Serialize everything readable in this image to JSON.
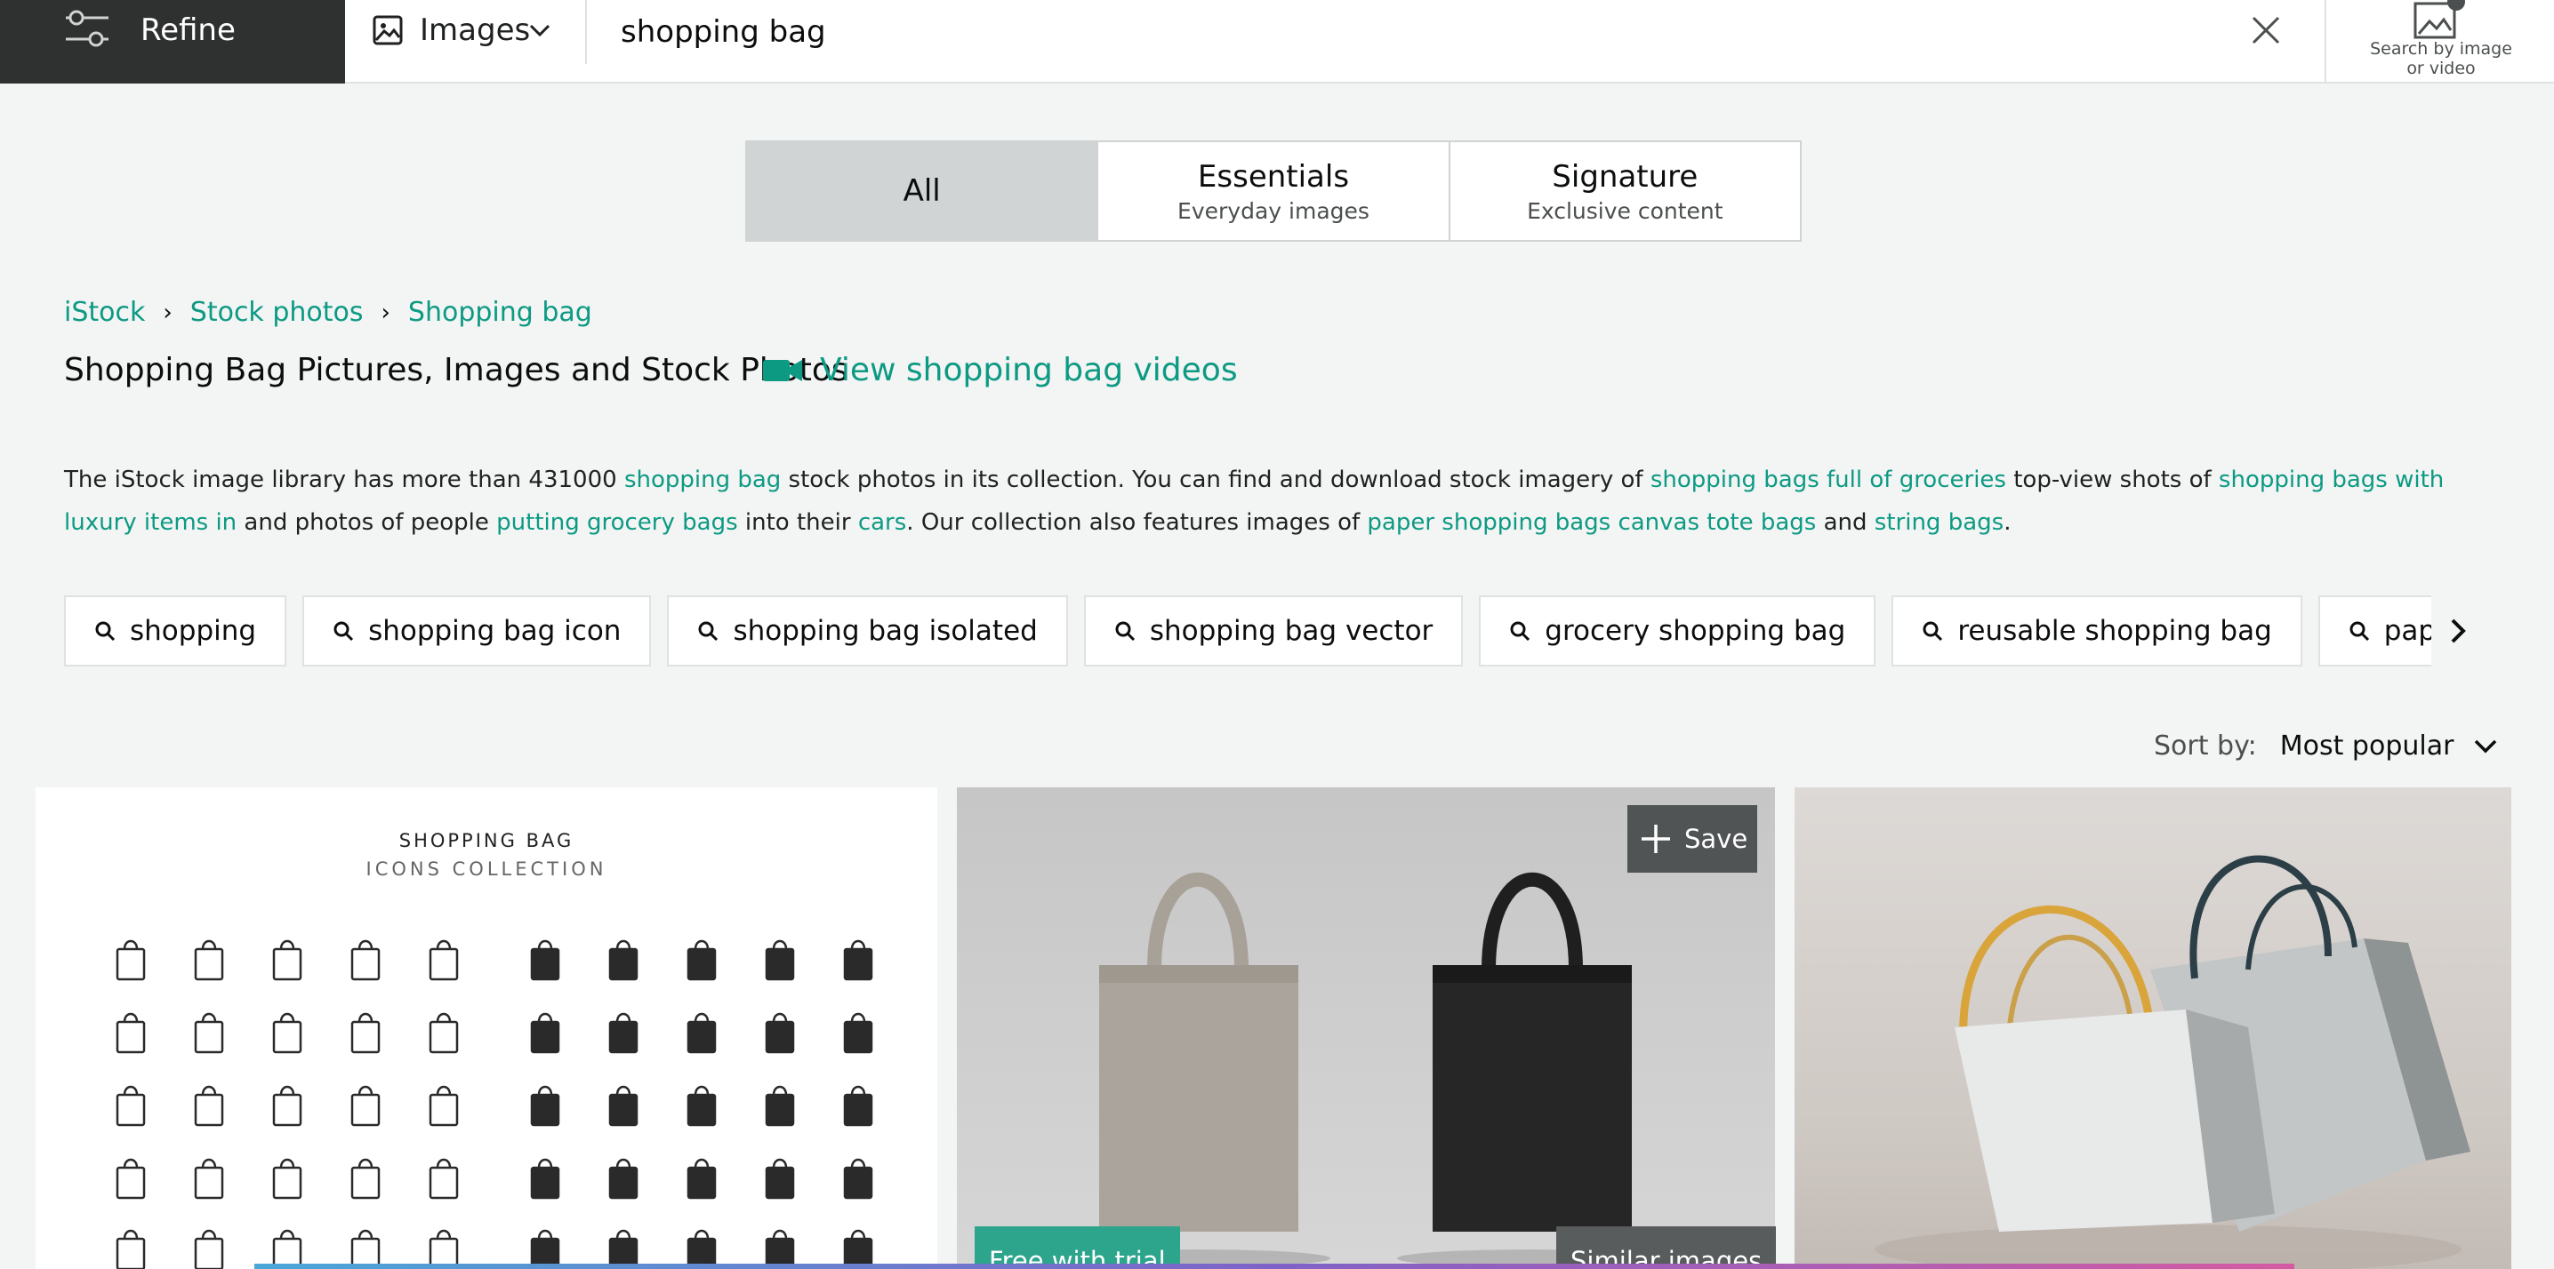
{
  "header": {
    "refine_label": "Refine",
    "media_type": "Images",
    "search_value": "shopping bag",
    "search_by_image_label": "Search by image\nor video"
  },
  "license_tabs": [
    {
      "label": "All",
      "sub": "",
      "active": true
    },
    {
      "label": "Essentials",
      "sub": "Everyday images",
      "active": false
    },
    {
      "label": "Signature",
      "sub": "Exclusive content",
      "active": false
    }
  ],
  "breadcrumb": [
    "iStock",
    "Stock photos",
    "Shopping bag"
  ],
  "page_title": "Shopping Bag Pictures, Images and Stock Photos",
  "video_link": "View shopping bag videos",
  "description": {
    "t1": "The iStock image library has more than 431000 ",
    "l1": "shopping bag",
    "t2": " stock photos in its collection. You can find and download stock imagery of ",
    "l2": "shopping bags full of groceries",
    "t3": " top-view shots of ",
    "l3": "shopping bags with luxury items in",
    "t4": " and photos of people ",
    "l4": "putting grocery bags",
    "t5": " into their ",
    "l5": "cars",
    "t6": ". Our collection also features images of ",
    "l6": "paper shopping bags canvas tote bags",
    "t7": " and ",
    "l7": "string bags",
    "t8": "."
  },
  "related_searches": [
    "shopping",
    "shopping bag icon",
    "shopping bag isolated",
    "shopping bag vector",
    "grocery shopping bag",
    "reusable shopping bag",
    "paper shopping bag"
  ],
  "sort": {
    "label": "Sort by:",
    "value": "Most popular"
  },
  "results": {
    "tile1": {
      "title": "SHOPPING   BAG",
      "subtitle": "ICONS   COLLECTION"
    },
    "save_label": "Save",
    "free_badge": "Free with trial",
    "similar_badge": "Similar images"
  },
  "colors": {
    "accent": "#0c9a83",
    "refine_bg": "#2f3030",
    "tab_active": "#d0d4d4"
  },
  "icons": [
    "sliders-icon",
    "image-icon",
    "chevron-down-icon",
    "close-icon",
    "camera-search-icon",
    "video-camera-icon",
    "search-icon",
    "chevron-right-icon",
    "plus-icon"
  ]
}
